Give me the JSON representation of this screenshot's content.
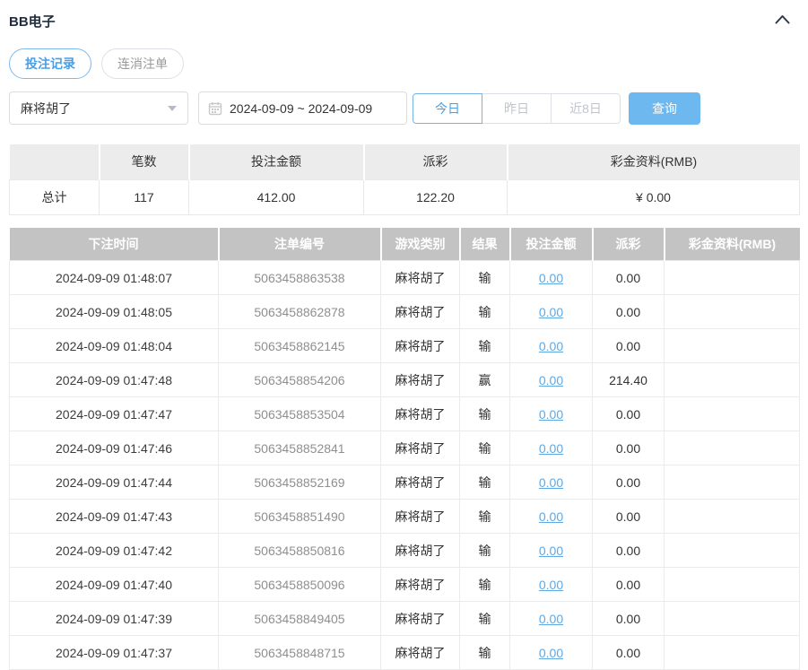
{
  "page": {
    "title": "BB电子"
  },
  "icons": {
    "collapse": "chevron-up-icon",
    "calendar": "calendar-icon",
    "select_caret": "caret-down-icon"
  },
  "colors": {
    "accent_blue": "#4a9ee4",
    "link_blue": "#5ca9e6",
    "query_button_bg": "#6db8ee",
    "table_header_bg": "#c3c3c3",
    "summary_header_bg": "#ececec"
  },
  "tabs": [
    {
      "label": "投注记录",
      "active": true
    },
    {
      "label": "连消注单",
      "active": false
    }
  ],
  "filters": {
    "game_select": {
      "value": "麻将胡了"
    },
    "date_range": {
      "value": "2024-09-09 ~ 2024-09-09"
    },
    "quick_ranges": [
      {
        "label": "今日",
        "active": true
      },
      {
        "label": "昨日",
        "active": false
      },
      {
        "label": "近8日",
        "active": false
      }
    ],
    "query_label": "查询"
  },
  "summary": {
    "headers": [
      "",
      "笔数",
      "投注金额",
      "派彩",
      "彩金资料(RMB)"
    ],
    "row": {
      "label": "总计",
      "count": "117",
      "bet_amount": "412.00",
      "payout": "122.20",
      "bonus": "¥ 0.00"
    }
  },
  "table": {
    "headers": [
      "下注时间",
      "注单编号",
      "游戏类别",
      "结果",
      "投注金额",
      "派彩",
      "彩金资料(RMB)"
    ],
    "rows": [
      {
        "time": "2024-09-09 01:48:07",
        "order_id": "5063458863538",
        "game": "麻将胡了",
        "result": "输",
        "bet": "0.00",
        "payout": "0.00",
        "bonus": ""
      },
      {
        "time": "2024-09-09 01:48:05",
        "order_id": "5063458862878",
        "game": "麻将胡了",
        "result": "输",
        "bet": "0.00",
        "payout": "0.00",
        "bonus": ""
      },
      {
        "time": "2024-09-09 01:48:04",
        "order_id": "5063458862145",
        "game": "麻将胡了",
        "result": "输",
        "bet": "0.00",
        "payout": "0.00",
        "bonus": ""
      },
      {
        "time": "2024-09-09 01:47:48",
        "order_id": "5063458854206",
        "game": "麻将胡了",
        "result": "赢",
        "bet": "0.00",
        "payout": "214.40",
        "bonus": ""
      },
      {
        "time": "2024-09-09 01:47:47",
        "order_id": "5063458853504",
        "game": "麻将胡了",
        "result": "输",
        "bet": "0.00",
        "payout": "0.00",
        "bonus": ""
      },
      {
        "time": "2024-09-09 01:47:46",
        "order_id": "5063458852841",
        "game": "麻将胡了",
        "result": "输",
        "bet": "0.00",
        "payout": "0.00",
        "bonus": ""
      },
      {
        "time": "2024-09-09 01:47:44",
        "order_id": "5063458852169",
        "game": "麻将胡了",
        "result": "输",
        "bet": "0.00",
        "payout": "0.00",
        "bonus": ""
      },
      {
        "time": "2024-09-09 01:47:43",
        "order_id": "5063458851490",
        "game": "麻将胡了",
        "result": "输",
        "bet": "0.00",
        "payout": "0.00",
        "bonus": ""
      },
      {
        "time": "2024-09-09 01:47:42",
        "order_id": "5063458850816",
        "game": "麻将胡了",
        "result": "输",
        "bet": "0.00",
        "payout": "0.00",
        "bonus": ""
      },
      {
        "time": "2024-09-09 01:47:40",
        "order_id": "5063458850096",
        "game": "麻将胡了",
        "result": "输",
        "bet": "0.00",
        "payout": "0.00",
        "bonus": ""
      },
      {
        "time": "2024-09-09 01:47:39",
        "order_id": "5063458849405",
        "game": "麻将胡了",
        "result": "输",
        "bet": "0.00",
        "payout": "0.00",
        "bonus": ""
      },
      {
        "time": "2024-09-09 01:47:37",
        "order_id": "5063458848715",
        "game": "麻将胡了",
        "result": "输",
        "bet": "0.00",
        "payout": "0.00",
        "bonus": ""
      }
    ]
  }
}
